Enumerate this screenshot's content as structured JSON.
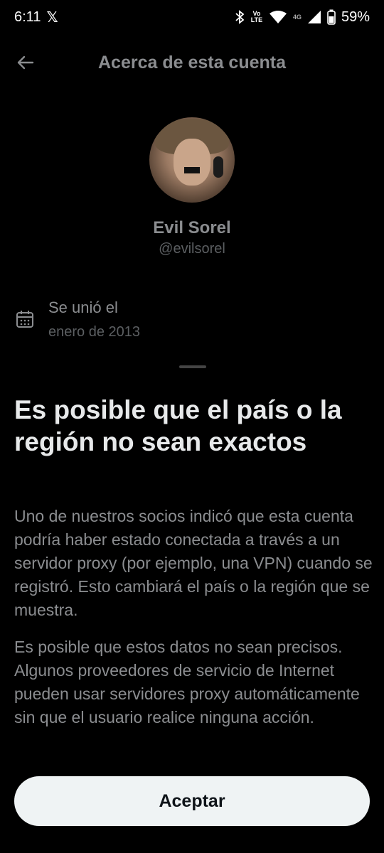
{
  "status_bar": {
    "time": "6:11",
    "x_logo": "𝕏",
    "volte": "Vo LTE",
    "network": "4G",
    "battery": "59%",
    "icons": [
      "bluetooth-icon",
      "volte-icon",
      "wifi-icon",
      "signal-icon",
      "battery-icon"
    ]
  },
  "header": {
    "title": "Acerca de esta cuenta",
    "back_icon": "arrow-left-icon"
  },
  "profile": {
    "name": "Evil Sorel",
    "handle": "@evilsorel"
  },
  "joined": {
    "icon": "calendar-icon",
    "label": "Se unió el",
    "value": "enero de 2013"
  },
  "sheet": {
    "title": "Es posible que el país o la región no sean exactos",
    "paragraph1": "Uno de nuestros socios indicó que esta cuenta podría haber estado conectada a través a un servidor proxy (por ejemplo, una VPN) cuando se registró. Esto cambiará el país o la región que se muestra.",
    "paragraph2": "Es posible que estos datos no sean precisos. Algunos proveedores de servicio de Internet pueden usar servidores proxy automáticamente sin que el usuario realice ninguna acción.",
    "accept_label": "Aceptar"
  },
  "colors": {
    "background": "#000000",
    "primary_text": "#e7e9ea",
    "secondary_text": "#8b8d90",
    "button_bg": "#eff3f4"
  }
}
